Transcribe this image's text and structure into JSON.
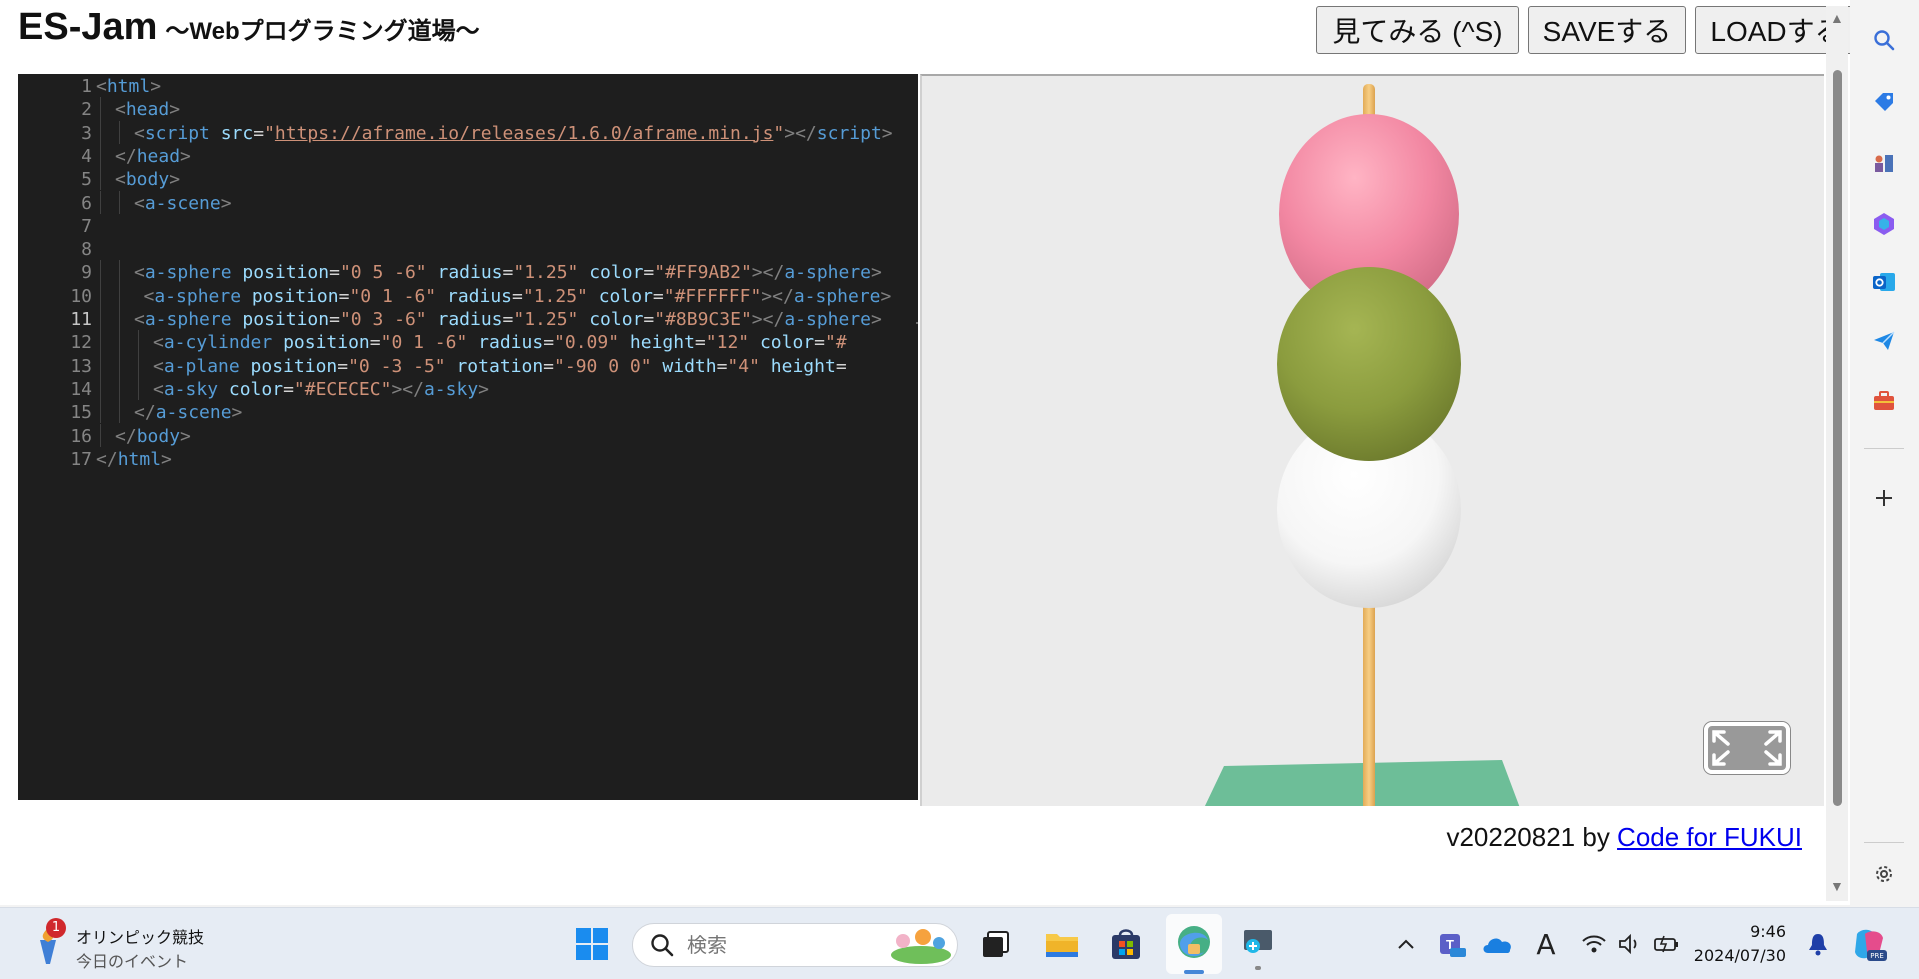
{
  "app": {
    "title": "ES-Jam",
    "subtitle": "～Webプログラミング道場～",
    "buttons": {
      "preview": "見てみる (^S)",
      "save": "SAVEする",
      "load": "LOADする"
    }
  },
  "editor": {
    "active_line": 11,
    "lines": [
      {
        "n": "1",
        "indent": 0,
        "tokens": [
          [
            "br",
            "<"
          ],
          [
            "tag",
            "html"
          ],
          [
            "br",
            ">"
          ]
        ]
      },
      {
        "n": "2",
        "indent": 1,
        "tokens": [
          [
            "br",
            "<"
          ],
          [
            "tag",
            "head"
          ],
          [
            "br",
            ">"
          ]
        ]
      },
      {
        "n": "3",
        "indent": 2,
        "tokens": [
          [
            "br",
            "<"
          ],
          [
            "tag",
            "script "
          ],
          [
            "attr",
            "src"
          ],
          [
            "txt",
            "="
          ],
          [
            "str",
            "\""
          ],
          [
            "url",
            "https://aframe.io/releases/1.6.0/aframe.min.js"
          ],
          [
            "str",
            "\""
          ],
          [
            "br",
            "></"
          ],
          [
            "tag",
            "script"
          ],
          [
            "br",
            ">"
          ]
        ]
      },
      {
        "n": "4",
        "indent": 1,
        "tokens": [
          [
            "br",
            "</"
          ],
          [
            "tag",
            "head"
          ],
          [
            "br",
            ">"
          ]
        ]
      },
      {
        "n": "5",
        "indent": 1,
        "tokens": [
          [
            "br",
            "<"
          ],
          [
            "tag",
            "body"
          ],
          [
            "br",
            ">"
          ]
        ]
      },
      {
        "n": "6",
        "indent": 2,
        "tokens": [
          [
            "br",
            "<"
          ],
          [
            "tag",
            "a-scene"
          ],
          [
            "br",
            ">"
          ]
        ]
      },
      {
        "n": "7",
        "indent": 0,
        "tokens": []
      },
      {
        "n": "8",
        "indent": 0,
        "tokens": []
      },
      {
        "n": "9",
        "indent": 2,
        "tokens": [
          [
            "br",
            "<"
          ],
          [
            "tag",
            "a-sphere "
          ],
          [
            "attr",
            "position"
          ],
          [
            "txt",
            "="
          ],
          [
            "str",
            "\"0 5 -6\" "
          ],
          [
            "attr",
            "radius"
          ],
          [
            "txt",
            "="
          ],
          [
            "str",
            "\"1.25\" "
          ],
          [
            "attr",
            "color"
          ],
          [
            "txt",
            "="
          ],
          [
            "str",
            "\"#FF9AB2\""
          ],
          [
            "br",
            "></"
          ],
          [
            "tag",
            "a-sphere"
          ],
          [
            "br",
            ">"
          ]
        ]
      },
      {
        "n": "10",
        "indent": 2.5,
        "tokens": [
          [
            "br",
            "<"
          ],
          [
            "tag",
            "a-sphere "
          ],
          [
            "attr",
            "position"
          ],
          [
            "txt",
            "="
          ],
          [
            "str",
            "\"0 1 -6\" "
          ],
          [
            "attr",
            "radius"
          ],
          [
            "txt",
            "="
          ],
          [
            "str",
            "\"1.25\" "
          ],
          [
            "attr",
            "color"
          ],
          [
            "txt",
            "="
          ],
          [
            "str",
            "\"#FFFFFF\""
          ],
          [
            "br",
            "></"
          ],
          [
            "tag",
            "a-sphere"
          ],
          [
            "br",
            ">"
          ]
        ]
      },
      {
        "n": "11",
        "indent": 2,
        "tokens": [
          [
            "br",
            "<"
          ],
          [
            "tag",
            "a-sphere "
          ],
          [
            "attr",
            "position"
          ],
          [
            "txt",
            "="
          ],
          [
            "str",
            "\"0 3 -6\" "
          ],
          [
            "attr",
            "radius"
          ],
          [
            "txt",
            "="
          ],
          [
            "str",
            "\"1.25\" "
          ],
          [
            "attr",
            "color"
          ],
          [
            "txt",
            "="
          ],
          [
            "str",
            "\"#8B9C3E\""
          ],
          [
            "br",
            "></"
          ],
          [
            "tag",
            "a-sphere"
          ],
          [
            "br",
            ">"
          ]
        ]
      },
      {
        "n": "12",
        "indent": 3,
        "tokens": [
          [
            "br",
            "<"
          ],
          [
            "tag",
            "a-cylinder "
          ],
          [
            "attr",
            "position"
          ],
          [
            "txt",
            "="
          ],
          [
            "str",
            "\"0 1 -6\" "
          ],
          [
            "attr",
            "radius"
          ],
          [
            "txt",
            "="
          ],
          [
            "str",
            "\"0.09\" "
          ],
          [
            "attr",
            "height"
          ],
          [
            "txt",
            "="
          ],
          [
            "str",
            "\"12\" "
          ],
          [
            "attr",
            "color"
          ],
          [
            "txt",
            "="
          ],
          [
            "str",
            "\"#"
          ]
        ]
      },
      {
        "n": "13",
        "indent": 3,
        "tokens": [
          [
            "br",
            "<"
          ],
          [
            "tag",
            "a-plane "
          ],
          [
            "attr",
            "position"
          ],
          [
            "txt",
            "="
          ],
          [
            "str",
            "\"0 -3 -5\" "
          ],
          [
            "attr",
            "rotation"
          ],
          [
            "txt",
            "="
          ],
          [
            "str",
            "\"-90 0 0\" "
          ],
          [
            "attr",
            "width"
          ],
          [
            "txt",
            "="
          ],
          [
            "str",
            "\"4\" "
          ],
          [
            "attr",
            "height"
          ],
          [
            "txt",
            "="
          ]
        ]
      },
      {
        "n": "14",
        "indent": 3,
        "tokens": [
          [
            "br",
            "<"
          ],
          [
            "tag",
            "a-sky "
          ],
          [
            "attr",
            "color"
          ],
          [
            "txt",
            "="
          ],
          [
            "str",
            "\"#ECECEC\""
          ],
          [
            "br",
            "></"
          ],
          [
            "tag",
            "a-sky"
          ],
          [
            "br",
            ">"
          ]
        ]
      },
      {
        "n": "15",
        "indent": 2,
        "tokens": [
          [
            "br",
            "</"
          ],
          [
            "tag",
            "a-scene"
          ],
          [
            "br",
            ">"
          ]
        ]
      },
      {
        "n": "16",
        "indent": 1,
        "tokens": [
          [
            "br",
            "</"
          ],
          [
            "tag",
            "body"
          ],
          [
            "br",
            ">"
          ]
        ]
      },
      {
        "n": "17",
        "indent": 0,
        "tokens": [
          [
            "br",
            "</"
          ],
          [
            "tag",
            "html"
          ],
          [
            "br",
            ">"
          ]
        ]
      }
    ]
  },
  "preview": {
    "sky": "#ECECEC",
    "spheres": [
      "#FF9AB2",
      "#8B9C3E",
      "#FFFFFF"
    ],
    "stick": "#F2C272",
    "plane": "#6DBE98",
    "fullscreen_icon": "fullscreen-icon"
  },
  "footer": {
    "version": "v20220821 by ",
    "link": "Code for FUKUI"
  },
  "taskbar": {
    "widget_title": "オリンピック競技",
    "widget_sub": "今日のイベント",
    "widget_badge": "1",
    "search_placeholder": "検索",
    "time": "9:46",
    "date": "2024/07/30",
    "ime": "A"
  }
}
